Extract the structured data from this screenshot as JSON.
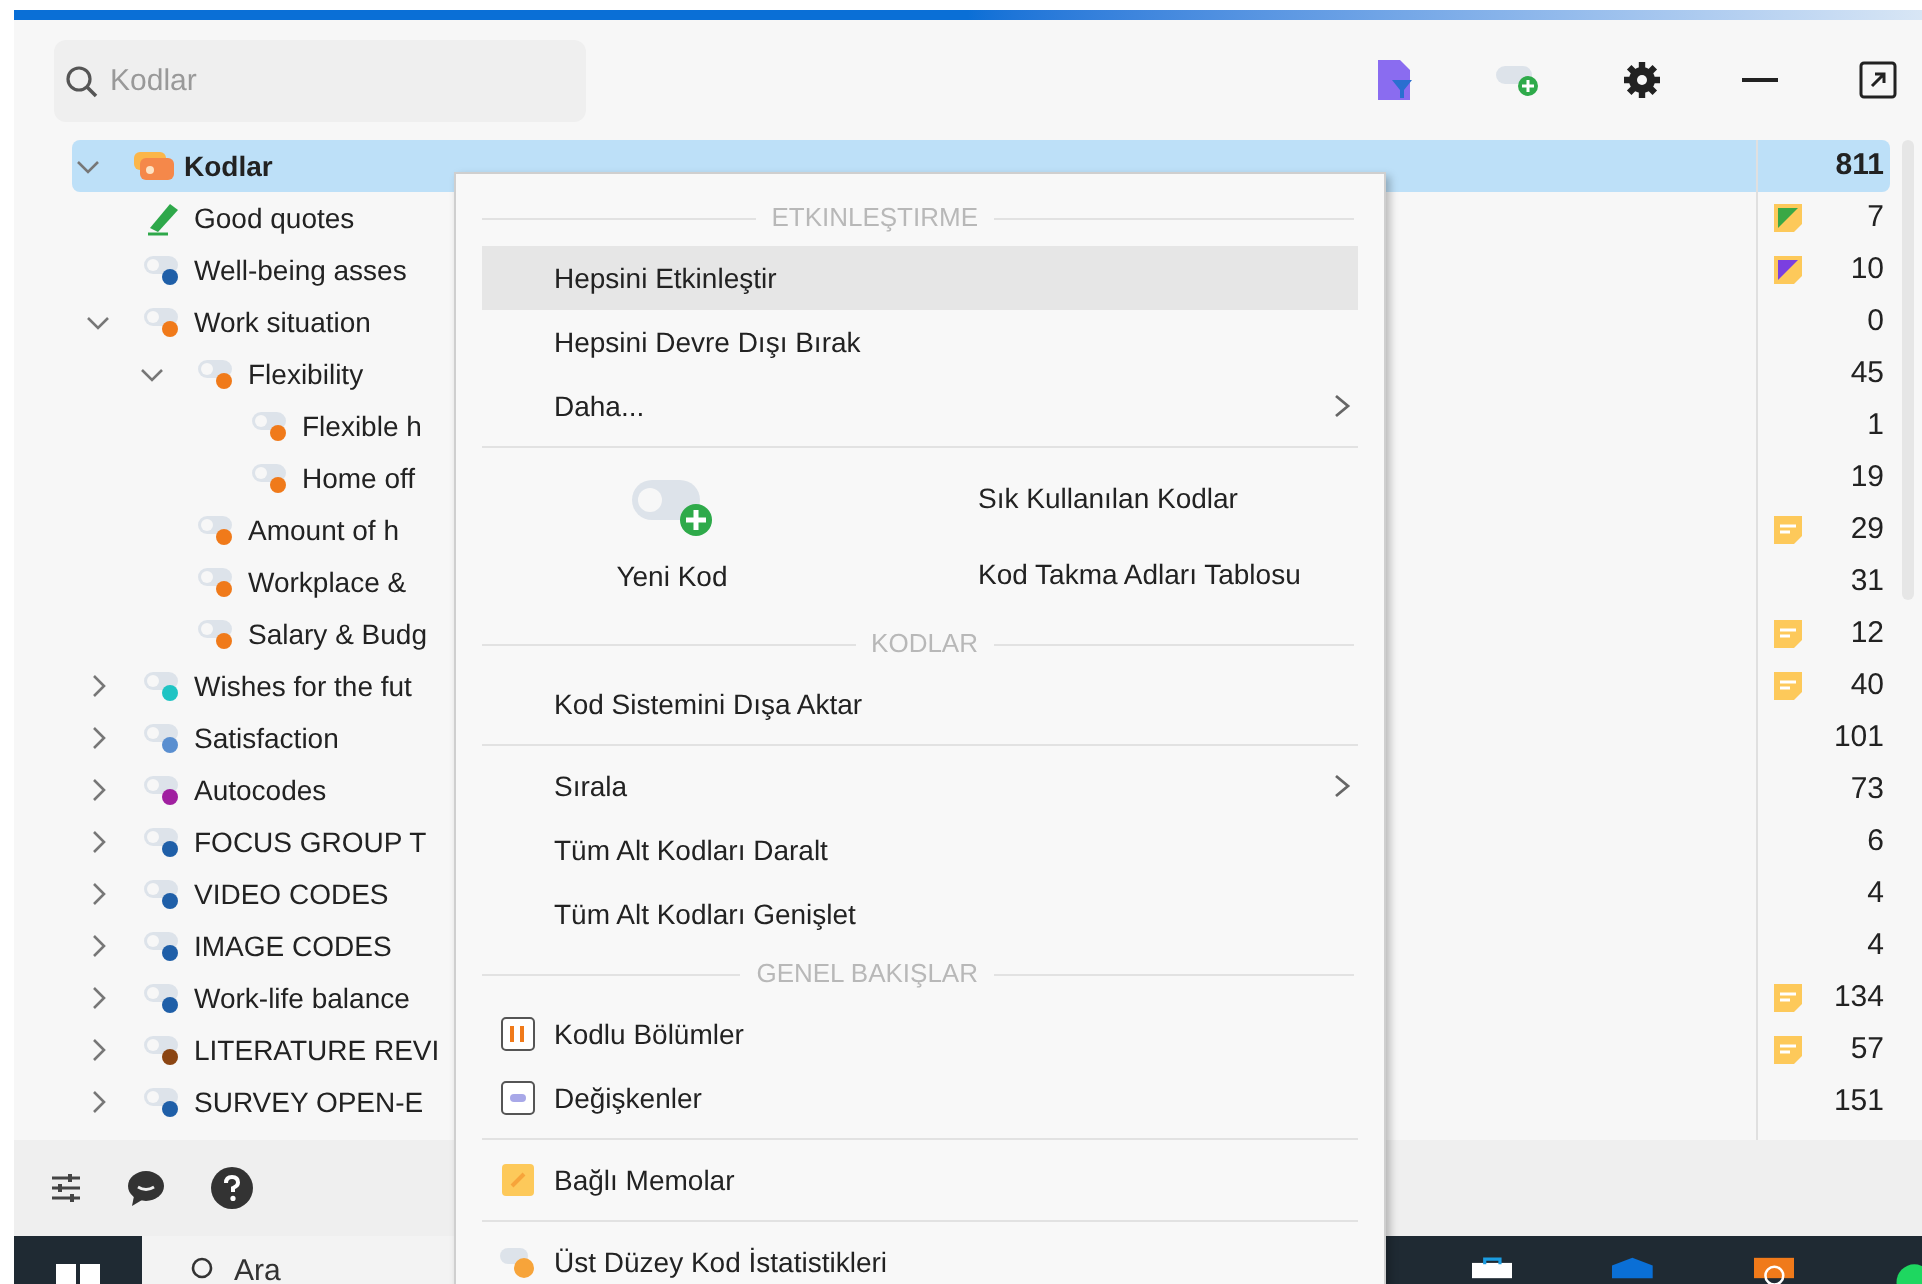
{
  "search": {
    "placeholder": "Kodlar"
  },
  "tree": [
    {
      "label": "Kodlar",
      "kind": "root",
      "count": "811",
      "selected": true,
      "expanded": true,
      "children": [
        {
          "label": "Good quotes",
          "kind": "highlight",
          "count": "7",
          "memo": {
            "kind": "colored",
            "color": "#3aa845"
          },
          "selected": false
        },
        {
          "label": "Well-being asses",
          "kind": "code",
          "color": "#1f5fa8",
          "count": "10",
          "memo": {
            "kind": "colored",
            "color": "#7b3fe0"
          },
          "selected": false
        },
        {
          "label": "Work situation",
          "kind": "code",
          "color": "#f07a1a",
          "count": "0",
          "selected": false,
          "expanded": true,
          "children": [
            {
              "label": "Flexibility",
              "kind": "code",
              "color": "#f07a1a",
              "count": "45",
              "selected": false,
              "expanded": true,
              "children": [
                {
                  "label": "Flexible h",
                  "kind": "code",
                  "color": "#f07a1a",
                  "count": "1",
                  "selected": false
                },
                {
                  "label": "Home off",
                  "kind": "code",
                  "color": "#f07a1a",
                  "count": "19",
                  "selected": false
                }
              ]
            },
            {
              "label": "Amount of h",
              "kind": "code",
              "color": "#f07a1a",
              "count": "29",
              "memo": {
                "kind": "plain"
              },
              "selected": false
            },
            {
              "label": "Workplace &",
              "kind": "code",
              "color": "#f07a1a",
              "count": "31",
              "selected": false
            },
            {
              "label": "Salary & Budg",
              "kind": "code",
              "color": "#f07a1a",
              "count": "12",
              "memo": {
                "kind": "plain"
              },
              "selected": false
            }
          ]
        },
        {
          "label": "Wishes for the fut",
          "kind": "code",
          "color": "#1fc4c4",
          "count": "40",
          "memo": {
            "kind": "plain"
          },
          "selected": false,
          "expanded": false
        },
        {
          "label": "Satisfaction",
          "kind": "code",
          "color": "#5a8fd0",
          "count": "101",
          "selected": false,
          "expanded": false
        },
        {
          "label": "Autocodes",
          "kind": "code",
          "color": "#a020a0",
          "count": "73",
          "selected": false,
          "expanded": false
        },
        {
          "label": "FOCUS GROUP T",
          "kind": "code",
          "color": "#1f5fa8",
          "count": "6",
          "selected": false,
          "expanded": false
        },
        {
          "label": "VIDEO CODES",
          "kind": "code",
          "color": "#1f5fa8",
          "count": "4",
          "selected": false,
          "expanded": false
        },
        {
          "label": "IMAGE CODES",
          "kind": "code",
          "color": "#1f5fa8",
          "count": "4",
          "selected": false,
          "expanded": false
        },
        {
          "label": "Work-life balance",
          "kind": "code",
          "color": "#1f5fa8",
          "count": "134",
          "memo": {
            "kind": "plain"
          },
          "selected": false,
          "expanded": false
        },
        {
          "label": "LITERATURE REVI",
          "kind": "code",
          "color": "#8b4513",
          "count": "57",
          "memo": {
            "kind": "plain"
          },
          "selected": false,
          "expanded": false
        },
        {
          "label": "SURVEY OPEN-E",
          "kind": "code",
          "color": "#1f5fa8",
          "count": "151",
          "selected": false,
          "expanded": false
        }
      ]
    }
  ],
  "menu": [
    {
      "kind": "header",
      "label": "ETKINLEŞTIRME"
    },
    {
      "kind": "item",
      "label": "Hepsini Etkinleştir",
      "highlighted": true
    },
    {
      "kind": "item",
      "label": "Hepsini Devre Dışı Bırak",
      "highlighted": false
    },
    {
      "kind": "item",
      "label": "Daha...",
      "highlighted": false,
      "submenu": true
    },
    {
      "kind": "divider"
    },
    {
      "kind": "tiles",
      "main": "Yeni Kod",
      "links": [
        "Sık Kullanılan Kodlar",
        "Kod Takma Adları Tablosu"
      ]
    },
    {
      "kind": "header",
      "label": "KODLAR"
    },
    {
      "kind": "item",
      "label": "Kod Sistemini Dışa Aktar",
      "highlighted": false
    },
    {
      "kind": "divider"
    },
    {
      "kind": "item",
      "label": "Sırala",
      "highlighted": false,
      "submenu": true
    },
    {
      "kind": "item",
      "label": "Tüm Alt Kodları Daralt",
      "highlighted": false
    },
    {
      "kind": "item",
      "label": "Tüm Alt Kodları Genişlet",
      "highlighted": false
    },
    {
      "kind": "header",
      "label": "GENEL BAKIŞLAR"
    },
    {
      "kind": "segments",
      "label": "Kodlu Bölümler",
      "highlighted": false
    },
    {
      "kind": "variables",
      "label": "Değişkenler",
      "highlighted": false
    },
    {
      "kind": "divider"
    },
    {
      "kind": "memos",
      "label": "Bağlı Memolar",
      "highlighted": false
    },
    {
      "kind": "divider"
    },
    {
      "kind": "stats",
      "label": "Üst Düzey Kod İstatistikleri",
      "highlighted": false
    }
  ],
  "taskbar": {
    "search": "Ara"
  }
}
